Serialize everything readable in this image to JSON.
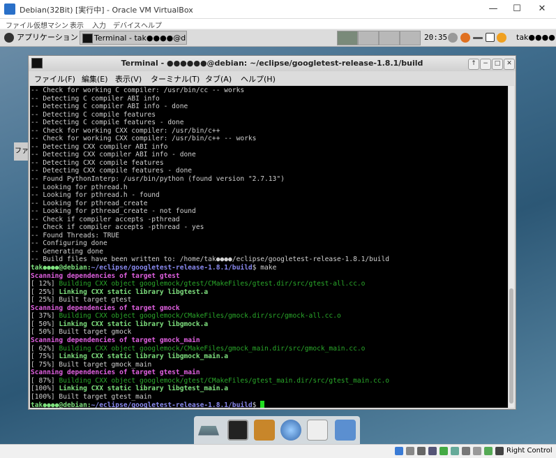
{
  "host": {
    "title": "Debian(32Bit) [実行中] - Oracle VM VirtualBox",
    "menu": [
      "ファイル",
      "仮想マシン",
      "表示",
      "入力",
      "デバイス",
      "ヘルプ"
    ],
    "controls": {
      "minimize": "—",
      "maximize": "☐",
      "close": "✕"
    },
    "status_right": "Right Control"
  },
  "guest_panel": {
    "apps_menu": "アプリケーション",
    "task_button": "Terminal - tak●●●●@d···",
    "clock": "20:35",
    "user": "tak●●●●"
  },
  "desktop": {
    "behind_window_label": "ファ"
  },
  "terminal": {
    "title": "Terminal - ●●●●●●@debian: ~/eclipse/googletest-release-1.8.1/build",
    "title_controls": [
      "↑",
      "−",
      "□",
      "✕"
    ],
    "menu": [
      "ファイル(F)",
      "編集(E)",
      "表示(V)",
      "ターミナル(T)",
      "タブ(A)",
      "ヘルプ(H)"
    ],
    "lines": [
      {
        "t": "plain",
        "text": "-- Check for working C compiler: /usr/bin/cc -- works"
      },
      {
        "t": "plain",
        "text": "-- Detecting C compiler ABI info"
      },
      {
        "t": "plain",
        "text": "-- Detecting C compiler ABI info - done"
      },
      {
        "t": "plain",
        "text": "-- Detecting C compile features"
      },
      {
        "t": "plain",
        "text": "-- Detecting C compile features - done"
      },
      {
        "t": "plain",
        "text": "-- Check for working CXX compiler: /usr/bin/c++"
      },
      {
        "t": "plain",
        "text": "-- Check for working CXX compiler: /usr/bin/c++ -- works"
      },
      {
        "t": "plain",
        "text": "-- Detecting CXX compiler ABI info"
      },
      {
        "t": "plain",
        "text": "-- Detecting CXX compiler ABI info - done"
      },
      {
        "t": "plain",
        "text": "-- Detecting CXX compile features"
      },
      {
        "t": "plain",
        "text": "-- Detecting CXX compile features - done"
      },
      {
        "t": "plain",
        "text": "-- Found PythonInterp: /usr/bin/python (found version \"2.7.13\")"
      },
      {
        "t": "plain",
        "text": "-- Looking for pthread.h"
      },
      {
        "t": "plain",
        "text": "-- Looking for pthread.h - found"
      },
      {
        "t": "plain",
        "text": "-- Looking for pthread_create"
      },
      {
        "t": "plain",
        "text": "-- Looking for pthread_create - not found"
      },
      {
        "t": "plain",
        "text": "-- Check if compiler accepts -pthread"
      },
      {
        "t": "plain",
        "text": "-- Check if compiler accepts -pthread - yes"
      },
      {
        "t": "plain",
        "text": "-- Found Threads: TRUE"
      },
      {
        "t": "plain",
        "text": "-- Configuring done"
      },
      {
        "t": "plain",
        "text": "-- Generating done"
      },
      {
        "t": "plain",
        "text": "-- Build files have been written to: /home/tak●●●●/eclipse/googletest-release-1.8.1/build"
      },
      {
        "t": "prompt",
        "user": "tak●●●●@debian:",
        "path": "~/eclipse/googletest-release-1.8.1/build",
        "cmd": "$ make"
      },
      {
        "t": "mag",
        "text": "Scanning dependencies of target gtest"
      },
      {
        "t": "build",
        "pct": "[ 12%] ",
        "text": "Building CXX object googlemock/gtest/CMakeFiles/gtest.dir/src/gtest-all.cc.o"
      },
      {
        "t": "link",
        "pct": "[ 25%] ",
        "text": "Linking CXX static library libgtest.a"
      },
      {
        "t": "plain",
        "text": "[ 25%] Built target gtest"
      },
      {
        "t": "mag",
        "text": "Scanning dependencies of target gmock"
      },
      {
        "t": "build",
        "pct": "[ 37%] ",
        "text": "Building CXX object googlemock/CMakeFiles/gmock.dir/src/gmock-all.cc.o"
      },
      {
        "t": "link",
        "pct": "[ 50%] ",
        "text": "Linking CXX static library libgmock.a"
      },
      {
        "t": "plain",
        "text": "[ 50%] Built target gmock"
      },
      {
        "t": "mag",
        "text": "Scanning dependencies of target gmock_main"
      },
      {
        "t": "build",
        "pct": "[ 62%] ",
        "text": "Building CXX object googlemock/CMakeFiles/gmock_main.dir/src/gmock_main.cc.o"
      },
      {
        "t": "link",
        "pct": "[ 75%] ",
        "text": "Linking CXX static library libgmock_main.a"
      },
      {
        "t": "plain",
        "text": "[ 75%] Built target gmock_main"
      },
      {
        "t": "mag",
        "text": "Scanning dependencies of target gtest_main"
      },
      {
        "t": "build",
        "pct": "[ 87%] ",
        "text": "Building CXX object googlemock/gtest/CMakeFiles/gtest_main.dir/src/gtest_main.cc.o"
      },
      {
        "t": "link",
        "pct": "[100%] ",
        "text": "Linking CXX static library libgtest_main.a"
      },
      {
        "t": "plain",
        "text": "[100%] Built target gtest_main"
      },
      {
        "t": "prompt_cursor",
        "user": "tak●●●●@debian:",
        "path": "~/eclipse/googletest-release-1.8.1/build",
        "cmd": "$ "
      }
    ]
  },
  "dock": {
    "items": [
      "workspace-switcher-icon",
      "terminal-icon",
      "file-manager-icon",
      "web-browser-icon",
      "app-finder-icon",
      "home-folder-icon"
    ]
  },
  "colors": {
    "prompt_user": "#7ee07e",
    "prompt_path": "#8a8af0",
    "scanning": "#e060e0",
    "building": "#2aa82a",
    "cursor": "#22dd22"
  }
}
